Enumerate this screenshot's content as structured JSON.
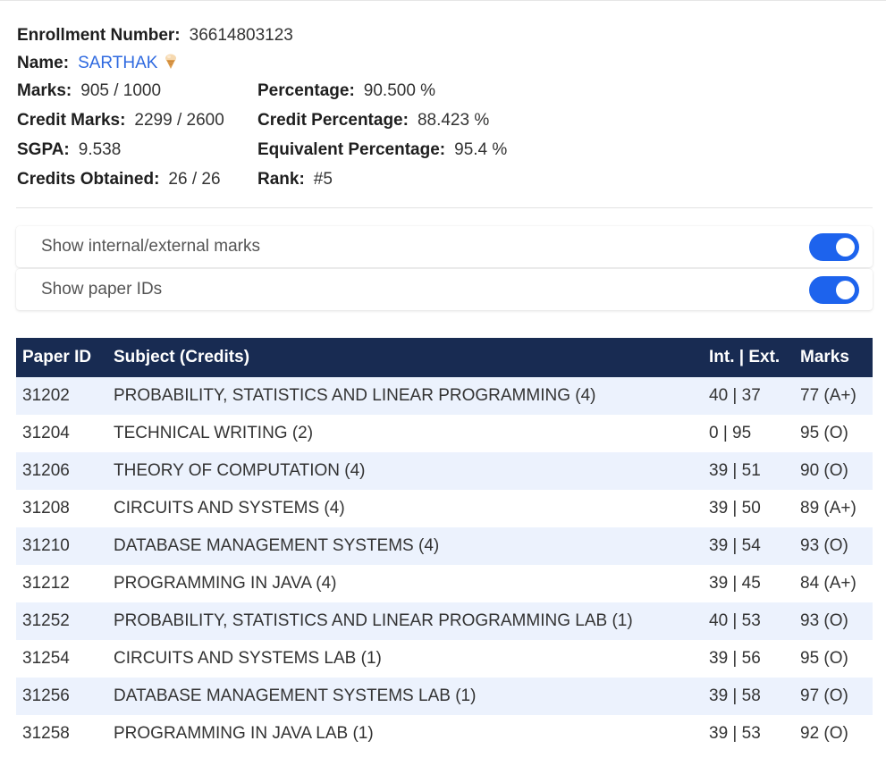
{
  "student": {
    "enrollment_label": "Enrollment Number:",
    "enrollment_value": "36614803123",
    "name_label": "Name:",
    "name_value": "SARTHAK",
    "name_emoji": "ice-cream-icon",
    "marks_label": "Marks:",
    "marks_value": "905 / 1000",
    "percentage_label": "Percentage:",
    "percentage_value": "90.500 %",
    "credit_marks_label": "Credit Marks:",
    "credit_marks_value": "2299 / 2600",
    "credit_percentage_label": "Credit Percentage:",
    "credit_percentage_value": "88.423 %",
    "sgpa_label": "SGPA:",
    "sgpa_value": "9.538",
    "equivalent_percentage_label": "Equivalent Percentage:",
    "equivalent_percentage_value": "95.4 %",
    "credits_obtained_label": "Credits Obtained:",
    "credits_obtained_value": "26 / 26",
    "rank_label": "Rank:",
    "rank_value": "#5"
  },
  "toggles": [
    {
      "label": "Show internal/external marks",
      "on": true
    },
    {
      "label": "Show paper IDs",
      "on": true
    }
  ],
  "table": {
    "headers": {
      "paper_id": "Paper ID",
      "subject": "Subject (Credits)",
      "int_ext": "Int. | Ext.",
      "marks": "Marks"
    },
    "rows": [
      {
        "paper_id": "31202",
        "subject": "PROBABILITY, STATISTICS AND LINEAR PROGRAMMING (4)",
        "int_ext": "40 | 37",
        "marks": "77 (A+)"
      },
      {
        "paper_id": "31204",
        "subject": "TECHNICAL WRITING (2)",
        "int_ext": "0 | 95",
        "marks": "95 (O)"
      },
      {
        "paper_id": "31206",
        "subject": "THEORY OF COMPUTATION (4)",
        "int_ext": "39 | 51",
        "marks": "90 (O)"
      },
      {
        "paper_id": "31208",
        "subject": "CIRCUITS AND SYSTEMS (4)",
        "int_ext": "39 | 50",
        "marks": "89 (A+)"
      },
      {
        "paper_id": "31210",
        "subject": "DATABASE MANAGEMENT SYSTEMS (4)",
        "int_ext": "39 | 54",
        "marks": "93 (O)"
      },
      {
        "paper_id": "31212",
        "subject": "PROGRAMMING IN JAVA (4)",
        "int_ext": "39 | 45",
        "marks": "84 (A+)"
      },
      {
        "paper_id": "31252",
        "subject": "PROBABILITY, STATISTICS AND LINEAR PROGRAMMING LAB (1)",
        "int_ext": "40 | 53",
        "marks": "93 (O)"
      },
      {
        "paper_id": "31254",
        "subject": "CIRCUITS AND SYSTEMS LAB (1)",
        "int_ext": "39 | 56",
        "marks": "95 (O)"
      },
      {
        "paper_id": "31256",
        "subject": "DATABASE MANAGEMENT SYSTEMS LAB (1)",
        "int_ext": "39 | 58",
        "marks": "97 (O)"
      },
      {
        "paper_id": "31258",
        "subject": "PROGRAMMING IN JAVA LAB (1)",
        "int_ext": "39 | 53",
        "marks": "92 (O)"
      }
    ]
  },
  "colors": {
    "header_bg": "#182b52",
    "stripe_bg": "#ecf2fd",
    "toggle_on": "#1d63ed",
    "name_link": "#2f6ae0"
  }
}
